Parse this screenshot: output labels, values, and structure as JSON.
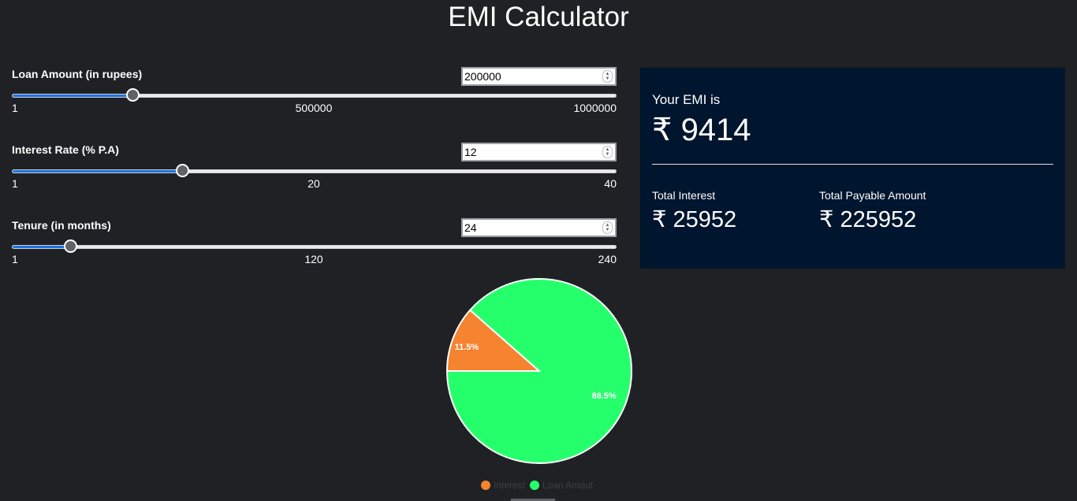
{
  "title": "EMI Calculator",
  "sliders": [
    {
      "label": "Loan Amount (in rupees)",
      "value": "200000",
      "min": "1",
      "mid": "500000",
      "max": "1000000",
      "position": 0.2
    },
    {
      "label": "Interest Rate (% P.A)",
      "value": "12",
      "min": "1",
      "mid": "20",
      "max": "40",
      "position": 0.282
    },
    {
      "label": "Tenure (in months)",
      "value": "24",
      "min": "1",
      "mid": "120",
      "max": "240",
      "position": 0.0962
    }
  ],
  "result": {
    "emi_label": "Your EMI is",
    "emi_value": "₹ 9414",
    "total_interest_label": "Total Interest",
    "total_interest_value": "₹ 25952",
    "total_payable_label": "Total Payable Amount",
    "total_payable_value": "₹ 225952"
  },
  "chart_data": {
    "type": "pie",
    "slices": [
      {
        "name": "Interest",
        "value": 11.5,
        "label": "11.5%",
        "color": "#f5832f"
      },
      {
        "name": "Loan Amout",
        "value": 88.5,
        "label": "88.5%",
        "color": "#26ff6c"
      }
    ],
    "legend_position": "bottom"
  },
  "colors": {
    "background": "#202124",
    "panel": "#00152e",
    "slider_fill": "#1a73e8"
  }
}
